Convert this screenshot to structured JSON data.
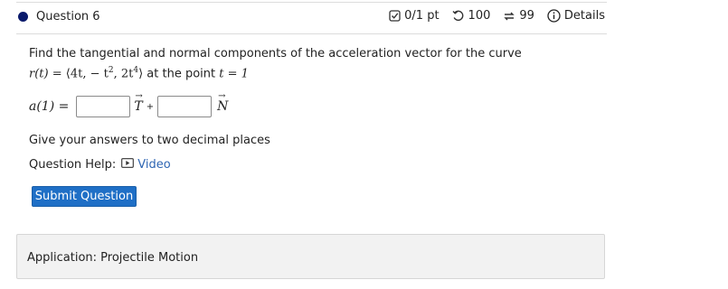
{
  "question": {
    "title": "Question 6",
    "score": "0/1 pt",
    "attempts": "100",
    "versions": "99",
    "details": "Details"
  },
  "problem": {
    "line1": "Find the tangential and normal components of the acceleration vector for the curve",
    "curve_lhs": "r(t) = ",
    "curve_vec_open": "⟨4t,  − t",
    "curve_mid": ", 2t",
    "curve_close": "⟩",
    "at_point": " at the point ",
    "point": "t = 1"
  },
  "answer": {
    "lhs": "a(1) = ",
    "t_symbol": "T",
    "plus": "+",
    "n_symbol": "N",
    "tangential_value": "",
    "normal_value": ""
  },
  "hint": "Give your answers to two decimal places",
  "help": {
    "label": "Question Help:",
    "video": "Video"
  },
  "submit_label": "Submit Question",
  "application": "Application: Projectile Motion"
}
